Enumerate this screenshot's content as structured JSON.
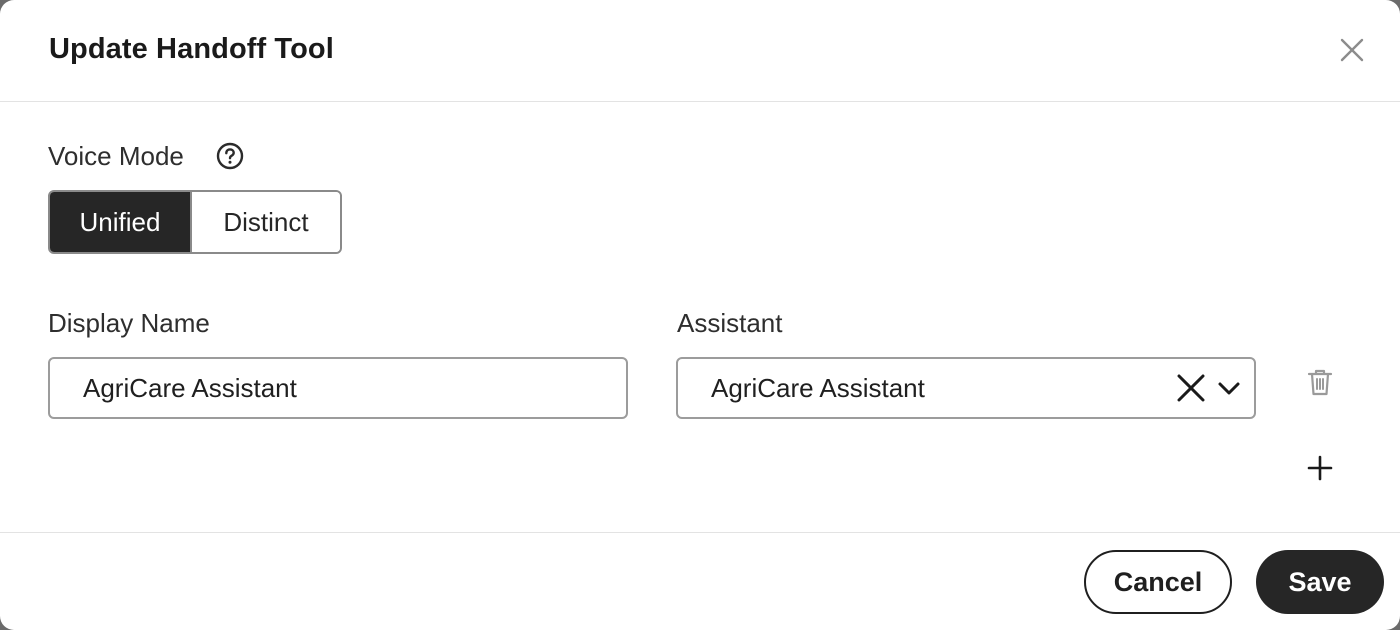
{
  "dialog": {
    "title": "Update Handoff Tool",
    "close_icon": "close-icon"
  },
  "voice_mode": {
    "label": "Voice Mode",
    "help_icon": "question-circle-icon",
    "options": [
      "Unified",
      "Distinct"
    ],
    "selected": "Unified"
  },
  "display_name": {
    "label": "Display Name",
    "value": "AgriCare Assistant"
  },
  "assistant": {
    "label": "Assistant",
    "value": "AgriCare Assistant",
    "clear_icon": "clear-x-icon",
    "dropdown_icon": "chevron-down-icon"
  },
  "row_actions": {
    "delete_icon": "trash-icon",
    "add_icon": "plus-icon"
  },
  "footer": {
    "cancel_label": "Cancel",
    "save_label": "Save"
  },
  "colors": {
    "primary_dark": "#262626",
    "border": "#9c9c9c",
    "muted_icon": "#9a9a9a"
  }
}
